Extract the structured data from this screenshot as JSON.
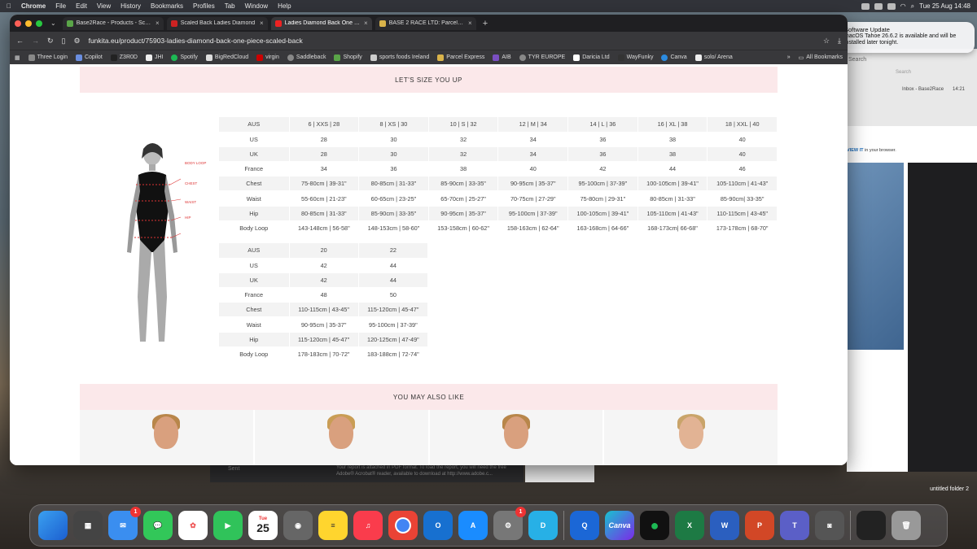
{
  "menubar": {
    "app": "Chrome",
    "items": [
      "File",
      "Edit",
      "View",
      "History",
      "Bookmarks",
      "Profiles",
      "Tab",
      "Window",
      "Help"
    ],
    "clock": "Tue 25 Aug  14:48"
  },
  "notification": {
    "title": "Software Update",
    "body": "macOS Tahoe 26.6.2 is available and will be installed later tonight."
  },
  "tabs": [
    {
      "label": "Base2Race - Products - Scale"
    },
    {
      "label": "Scaled Back Ladies Diamond"
    },
    {
      "label": "Ladies Diamond Back One Pie"
    },
    {
      "label": "BASE 2 RACE LTD: ParcelVisi"
    }
  ],
  "address": {
    "url": "funkita.eu/product/75903-ladies-diamond-back-one-piece-scaled-back"
  },
  "bookmarks": [
    "Three Login",
    "Copilot",
    "Z3R0D",
    "JHI",
    "Spotify",
    "BigRedCloud",
    "virgin",
    "Saddleback",
    "Shopify",
    "sports foods Ireland",
    "Parcel Express",
    "AIB",
    "TYR EUROPE",
    "Daricia Ltd",
    "WayFunky",
    "Canva",
    "solo/ Arena"
  ],
  "bookmarks_more": "»",
  "all_bookmarks": "All Bookmarks",
  "page": {
    "size_banner": "LET'S SIZE YOU UP",
    "also_banner": "YOU MAY ALSO LIKE",
    "model_labels": {
      "body_loop": "BODY LOOP",
      "chest": "CHEST",
      "waist": "WAIST",
      "hip": "HIP"
    },
    "table1": [
      [
        "AUS",
        "6 | XXS | 28",
        "8 | XS | 30",
        "10 | S | 32",
        "12 | M | 34",
        "14 | L | 36",
        "16 | XL | 38",
        "18 | XXL | 40"
      ],
      [
        "US",
        "28",
        "30",
        "32",
        "34",
        "36",
        "38",
        "40"
      ],
      [
        "UK",
        "28",
        "30",
        "32",
        "34",
        "36",
        "38",
        "40"
      ],
      [
        "France",
        "34",
        "36",
        "38",
        "40",
        "42",
        "44",
        "46"
      ],
      [
        "Chest",
        "75-80cm | 39-31\"",
        "80-85cm | 31-33\"",
        "85-90cm | 33-35\"",
        "90-95cm | 35-37\"",
        "95-100cm | 37-39\"",
        "100-105cm | 39-41\"",
        "105-110cm | 41-43\""
      ],
      [
        "Waist",
        "55-60cm | 21-23\"",
        "60-65cm | 23-25\"",
        "65-70cm | 25-27\"",
        "70-75cm | 27-29\"",
        "75-80cm | 29-31\"",
        "80-85cm | 31-33\"",
        "85-90cm| 33-35\""
      ],
      [
        "Hip",
        "80-85cm | 31-33\"",
        "85-90cm | 33-35\"",
        "90-95cm | 35-37\"",
        "95-100cm | 37-39\"",
        "100-105cm | 39-41\"",
        "105-110cm | 41-43\"",
        "110-115cm | 43-45\""
      ],
      [
        "Body Loop",
        "143-148cm | 56-58\"",
        "148-153cm | 58-60\"",
        "153-158cm | 60-62\"",
        "158-163cm | 62-64\"",
        "163-168cm | 64-66\"",
        "168-173cm| 66-68\"",
        "173-178cm | 68-70\""
      ]
    ],
    "table2": [
      [
        "AUS",
        "20",
        "22"
      ],
      [
        "US",
        "42",
        "44"
      ],
      [
        "UK",
        "42",
        "44"
      ],
      [
        "France",
        "48",
        "50"
      ],
      [
        "Chest",
        "110-115cm | 43-45\"",
        "115-120cm | 45-47\""
      ],
      [
        "Waist",
        "90-95cm | 35-37\"",
        "95-100cm | 37-39\""
      ],
      [
        "Hip",
        "115-120cm | 45-47\"",
        "120-125cm | 47-49\""
      ],
      [
        "Body Loop",
        "178-183cm | 70-72\"",
        "183-188cm | 72-74\""
      ]
    ]
  },
  "background_app": {
    "search": "Search",
    "search2": "Search",
    "inbox": "Inbox - Base2Race",
    "time": "14:21",
    "view_link": "VIEW IT",
    "view_rest": "in your browser.",
    "sent": "Sent",
    "mail_text": "Your report is attached in PDF format. To load the report, you will need the free Adobe® Acrobat® reader, available to download at http://www.adobe.c..."
  },
  "desktop": {
    "folder": "untitled folder 2"
  },
  "dock": {
    "calendar_day": "25",
    "calendar_month": "Tue",
    "badge_mail": "1",
    "badge_settings": "1",
    "canva": "Canva"
  }
}
